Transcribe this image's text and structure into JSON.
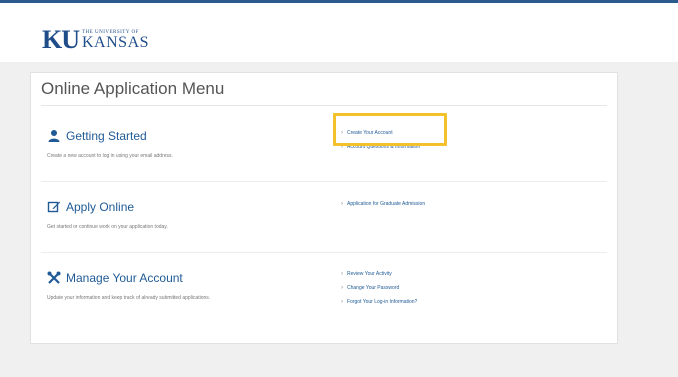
{
  "header": {
    "logo_ku": "KU",
    "logo_small": "THE UNIVERSITY OF",
    "logo_kansas": "KANSAS"
  },
  "panel": {
    "title": "Online Application Menu"
  },
  "sections": [
    {
      "title": "Getting Started",
      "icon": "user-icon",
      "description": "Create a new account to log in using your email address.",
      "links": [
        "Create Your Account",
        "Account Questions & Information"
      ]
    },
    {
      "title": "Apply Online",
      "icon": "edit-icon",
      "description": "Get started or continue work on your application today.",
      "links": [
        "Application for Graduate Admission"
      ]
    },
    {
      "title": "Manage Your Account",
      "icon": "tools-icon",
      "description": "Update your information and keep track of already submitted applications.",
      "links": [
        "Review Your Activity",
        "Change Your Password",
        "Forgot Your Log-in Information?"
      ]
    }
  ],
  "colors": {
    "brand_blue": "#1f4d8a",
    "link_blue": "#1f5a96",
    "highlight": "#f3c12c"
  }
}
